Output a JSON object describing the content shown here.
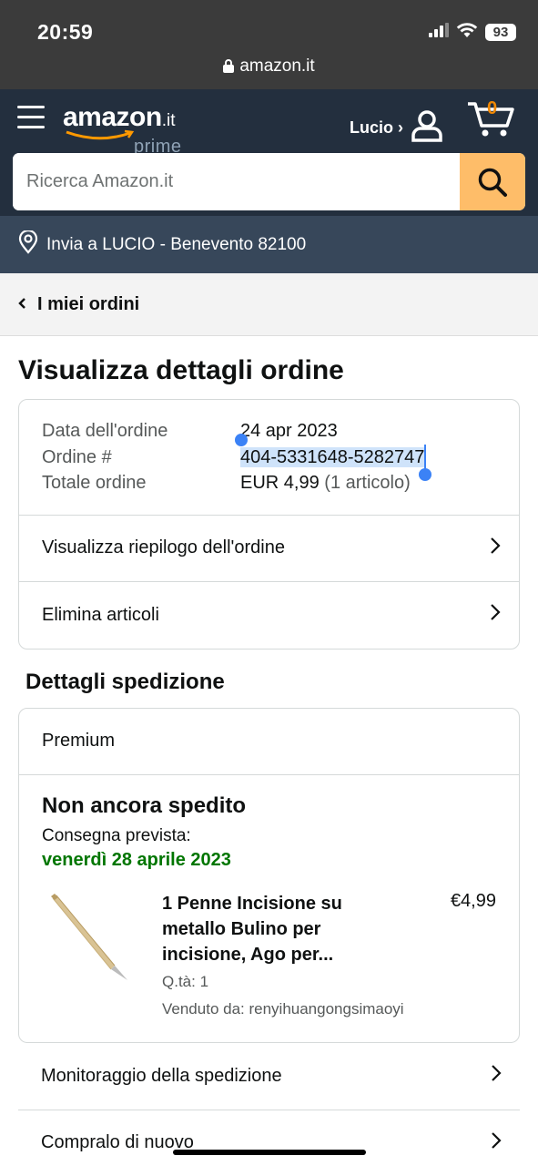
{
  "status": {
    "time": "20:59",
    "url": "amazon.it",
    "battery": "93"
  },
  "header": {
    "logo_text": "amazon",
    "logo_tld": ".it",
    "logo_prime": "prime",
    "account_label": "Lucio ›",
    "cart_count": "0",
    "search_placeholder": "Ricerca Amazon.it"
  },
  "deliver": {
    "text": "Invia a LUCIO - Benevento 82100"
  },
  "back": {
    "label": "I miei ordini"
  },
  "page_title": "Visualizza dettagli ordine",
  "order": {
    "date_label": "Data dell'ordine",
    "date_value": "24 apr 2023",
    "number_label": "Ordine #",
    "number_value": "404-5331648-5282747",
    "total_label": "Totale ordine",
    "total_value": "EUR 4,99",
    "total_items": "(1 articolo)",
    "links": [
      "Visualizza riepilogo dell'ordine",
      "Elimina articoli"
    ]
  },
  "shipping": {
    "title": "Dettagli spedizione",
    "method": "Premium",
    "status": "Non ancora spedito",
    "expected_label": "Consegna prevista:",
    "expected_date": "venerdì 28 aprile 2023",
    "item": {
      "title_line1": "1 Penne Incisione su",
      "title_line2": "metallo Bulino per",
      "title_line3": "incisione, Ago per...",
      "qty": "Q.tà: 1",
      "seller": "Venduto da: renyihuangongsimaoyi",
      "price": "€4,99"
    }
  },
  "bottom_links": [
    "Monitoraggio della spedizione",
    "Compralo di nuovo"
  ],
  "colors": {
    "header": "#232f3e",
    "deliver": "#37475a",
    "search_button": "#febd69",
    "cart_count": "#f08804",
    "delivery_date": "#007600",
    "selection": "#cfe3fa"
  }
}
